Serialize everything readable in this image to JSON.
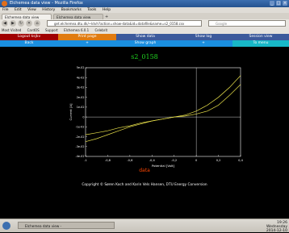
{
  "window": {
    "title": "Elchemea data view - Mozilla Firefox",
    "controls": [
      "_",
      "□",
      "×"
    ]
  },
  "menu": [
    "File",
    "Edit",
    "View",
    "History",
    "Bookmarks",
    "Tools",
    "Help"
  ],
  "tabs": [
    {
      "label": "Elchemea data view",
      "active": true
    },
    {
      "label": "Elchemea data view",
      "active": false
    }
  ],
  "nav": {
    "url": "get.elchemea.dtu.dk/~ktvh?action=show-data&id=datafile&name=s2_0158.csv",
    "search_placeholder": "Google"
  },
  "bookmarks": [
    "Most Visited",
    "CardOS",
    "Support",
    "Elchemea 6.0.1",
    "Celebrit"
  ],
  "toolbar": {
    "row1": [
      {
        "label": "Logout ksjkv",
        "color": "#a00000"
      },
      {
        "label": "Print page",
        "color": "#e07b10"
      },
      {
        "label": "Show data",
        "color": "#3c5a9c"
      },
      {
        "label": "Show log",
        "color": "#3c5a9c"
      },
      {
        "label": "Session view",
        "color": "#3c5a9c"
      }
    ],
    "row2": [
      {
        "label": "Back",
        "color": "#1a8fe0"
      },
      {
        "label": "+",
        "color": "#1a8fe0"
      },
      {
        "label": "Show graph",
        "color": "#1a8fe0"
      },
      {
        "label": "+",
        "color": "#1a8fe0"
      },
      {
        "label": "To menu",
        "color": "#18b8c8"
      }
    ]
  },
  "chart_data": {
    "type": "line",
    "title": "s2_0158",
    "xlabel": "Potential [Volt]",
    "ylabel": "Current [A]",
    "xlim": [
      -1,
      0.4
    ],
    "ylim": [
      -0.04,
      0.05
    ],
    "xticks": [
      "-1",
      "-0,8",
      "-0,6",
      "-0,4",
      "-0,2",
      "0",
      "0,2",
      "0,4"
    ],
    "yticks": [
      "-4e-02",
      "-3e-02",
      "-2e-02",
      "-1e-02",
      "0",
      "1e-02",
      "2e-02",
      "3e-02",
      "4e-02",
      "5e-02"
    ],
    "grid": false,
    "legend": "bottom",
    "series": [
      {
        "name": "data",
        "color": "#e8e04a",
        "x": [
          -1.0,
          -0.9,
          -0.8,
          -0.7,
          -0.6,
          -0.5,
          -0.4,
          -0.3,
          -0.2,
          -0.1,
          0.0,
          0.1,
          0.2,
          0.3,
          0.4
        ],
        "y": [
          -0.025,
          -0.022,
          -0.018,
          -0.014,
          -0.01,
          -0.007,
          -0.004,
          -0.002,
          0.0,
          0.001,
          0.003,
          0.006,
          0.012,
          0.022,
          0.033
        ]
      },
      {
        "name": "",
        "color": "#e8e04a",
        "x": [
          -1.0,
          -0.9,
          -0.8,
          -0.7,
          -0.6,
          -0.5,
          -0.4,
          -0.3,
          -0.2,
          -0.1,
          0.0,
          0.1,
          0.2,
          0.3,
          0.4
        ],
        "y": [
          -0.018,
          -0.016,
          -0.014,
          -0.011,
          -0.009,
          -0.006,
          -0.004,
          -0.002,
          0.0,
          0.002,
          0.006,
          0.012,
          0.02,
          0.03,
          0.042
        ]
      }
    ]
  },
  "plot": {
    "legend_label": "data",
    "copyright": "Copyright © Søren Koch and Karin Vels Hansen, DTU Energy Conversion"
  },
  "taskbar": {
    "item": "Elchemea data view -",
    "time": "19:26",
    "day": "Wednesday",
    "date": "2014-12-10"
  },
  "colors": {
    "accent_green": "#21d421",
    "curve": "#e8e04a",
    "legend_red": "#ff4500"
  }
}
